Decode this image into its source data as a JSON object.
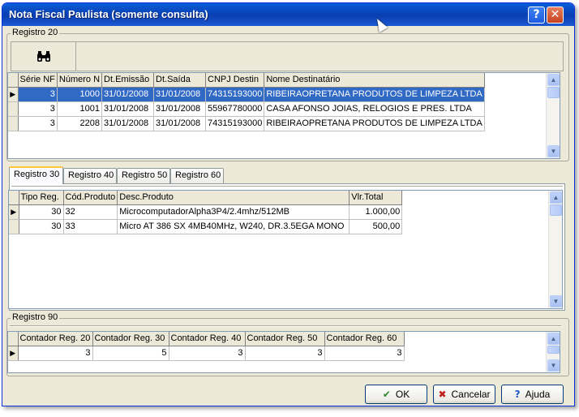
{
  "window": {
    "title": "Nota Fiscal Paulista (somente consulta)",
    "help_glyph": "?",
    "close_glyph": "✕"
  },
  "registro20": {
    "label": "Registro 20",
    "search_icon": "binoculars-icon",
    "columns": [
      "Série NF",
      "Número N",
      "Dt.Emissão",
      "Dt.Saída",
      "CNPJ Destin",
      "Nome Destinatário"
    ],
    "rows": [
      [
        "3",
        "1000",
        "31/01/2008",
        "31/01/2008",
        "74315193000",
        "RIBEIRAOPRETANA PRODUTOS DE LIMPEZA LTDA"
      ],
      [
        "3",
        "1001",
        "31/01/2008",
        "31/01/2008",
        "55967780000",
        "CASA AFONSO JOIAS, RELOGIOS E PRES. LTDA"
      ],
      [
        "3",
        "2208",
        "31/01/2008",
        "31/01/2008",
        "74315193000",
        "RIBEIRAOPRETANA PRODUTOS DE LIMPEZA LTDA"
      ]
    ],
    "selected_row": 0
  },
  "tabs": [
    "Registro 30",
    "Registro 40",
    "Registro 50",
    "Registro 60"
  ],
  "active_tab": 0,
  "registro30": {
    "columns": [
      "Tipo Reg.",
      "Cód.Produto",
      "Desc.Produto",
      "Vlr.Total"
    ],
    "rows": [
      [
        "30",
        "32",
        "MicrocomputadorAlpha3P4/2.4mhz/512MB",
        "1.000,00"
      ],
      [
        "30",
        "33",
        "Micro AT 386 SX 4MB40MHz, W240, DR.3.5EGA MONO",
        "500,00"
      ]
    ]
  },
  "registro90": {
    "label": "Registro 90",
    "columns": [
      "Contador Reg. 20",
      "Contador Reg. 30",
      "Contador Reg. 40",
      "Contador Reg. 50",
      "Contador Reg. 60"
    ],
    "rows": [
      [
        "3",
        "5",
        "3",
        "3",
        "3"
      ]
    ]
  },
  "buttons": {
    "ok": "OK",
    "cancel": "Cancelar",
    "help": "Ajuda"
  },
  "colors": {
    "titlebar": "#0842b8",
    "selection": "#316ac5",
    "window_bg": "#ece9d8"
  }
}
